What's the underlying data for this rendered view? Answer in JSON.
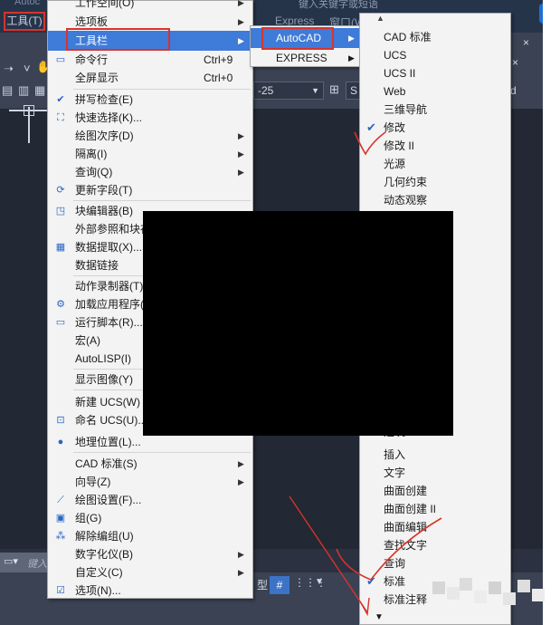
{
  "window": {
    "app_title": "Autoc",
    "tools_menu_label": "工具(T)",
    "express_menu_label": "Express",
    "window_menu_label": "窗口(W)",
    "search_hint": "键入关键字或短语"
  },
  "ribbon": {
    "dimstyle_value": "-25",
    "textstyle_value": "S",
    "standard_value": "ndard",
    "close_glyph": "×"
  },
  "tools_menu": {
    "items": [
      {
        "label": "工作空间(O)",
        "shortcut": "",
        "submenu": true
      },
      {
        "label": "选项板",
        "shortcut": "",
        "submenu": true
      },
      {
        "label": "工具栏",
        "shortcut": "",
        "submenu": true
      },
      {
        "label": "命令行",
        "shortcut": "Ctrl+9",
        "submenu": false
      },
      {
        "label": "全屏显示",
        "shortcut": "Ctrl+0",
        "submenu": false
      },
      {
        "label": "拼写检查(E)",
        "shortcut": "",
        "submenu": false
      },
      {
        "label": "快速选择(K)...",
        "shortcut": "",
        "submenu": false
      },
      {
        "label": "绘图次序(D)",
        "shortcut": "",
        "submenu": true
      },
      {
        "label": "隔离(I)",
        "shortcut": "",
        "submenu": true
      },
      {
        "label": "查询(Q)",
        "shortcut": "",
        "submenu": true
      },
      {
        "label": "更新字段(T)",
        "shortcut": "",
        "submenu": false
      },
      {
        "label": "块编辑器(B)",
        "shortcut": "",
        "submenu": false
      },
      {
        "label": "外部参照和块在",
        "shortcut": "",
        "submenu": false
      },
      {
        "label": "数据提取(X)...",
        "shortcut": "",
        "submenu": false
      },
      {
        "label": "数据链接",
        "shortcut": "",
        "submenu": false
      },
      {
        "label": "动作录制器(T)",
        "shortcut": "",
        "submenu": false
      },
      {
        "label": "加载应用程序(",
        "shortcut": "",
        "submenu": false
      },
      {
        "label": "运行脚本(R)...",
        "shortcut": "",
        "submenu": false
      },
      {
        "label": "宏(A)",
        "shortcut": "",
        "submenu": false
      },
      {
        "label": "AutoLISP(I)",
        "shortcut": "",
        "submenu": false
      },
      {
        "label": "显示图像(Y)",
        "shortcut": "",
        "submenu": false
      },
      {
        "label": "新建 UCS(W)",
        "shortcut": "",
        "submenu": false
      },
      {
        "label": "命名 UCS(U)...",
        "shortcut": "",
        "submenu": false
      },
      {
        "label": "地理位置(L)...",
        "shortcut": "",
        "submenu": false
      },
      {
        "label": "CAD 标准(S)",
        "shortcut": "",
        "submenu": true
      },
      {
        "label": "向导(Z)",
        "shortcut": "",
        "submenu": true
      },
      {
        "label": "绘图设置(F)...",
        "shortcut": "",
        "submenu": false
      },
      {
        "label": "组(G)",
        "shortcut": "",
        "submenu": false
      },
      {
        "label": "解除编组(U)",
        "shortcut": "",
        "submenu": false
      },
      {
        "label": "数字化仪(B)",
        "shortcut": "",
        "submenu": true
      },
      {
        "label": "自定义(C)",
        "shortcut": "",
        "submenu": true
      },
      {
        "label": "选项(N)...",
        "shortcut": "",
        "submenu": false
      }
    ],
    "highlighted_item": "工具栏"
  },
  "toolbar_submenu": {
    "items": [
      "AutoCAD",
      "EXPRESS"
    ],
    "highlighted_item": "AutoCAD"
  },
  "toolbar_list": {
    "items_top": [
      {
        "label": "CAD 标准",
        "checked": false
      },
      {
        "label": "UCS",
        "checked": false
      },
      {
        "label": "UCS II",
        "checked": false
      },
      {
        "label": "Web",
        "checked": false
      },
      {
        "label": "三维导航",
        "checked": false
      },
      {
        "label": "修改",
        "checked": true
      },
      {
        "label": "修改 II",
        "checked": false
      },
      {
        "label": "光源",
        "checked": false
      },
      {
        "label": "几何约束",
        "checked": false
      },
      {
        "label": "动态观察",
        "checked": false
      }
    ],
    "items_bottom": [
      {
        "label": "建筑",
        "checked": false
      },
      {
        "label": "插入",
        "checked": false
      },
      {
        "label": "文字",
        "checked": false
      },
      {
        "label": "曲面创建",
        "checked": false
      },
      {
        "label": "曲面创建 II",
        "checked": false
      },
      {
        "label": "曲面编辑",
        "checked": false
      },
      {
        "label": "查找文字",
        "checked": false
      },
      {
        "label": "查询",
        "checked": false
      },
      {
        "label": "标准",
        "checked": true
      },
      {
        "label": "标准注释",
        "checked": false
      }
    ]
  },
  "command_line": {
    "placeholder": "键入"
  },
  "statusbar": {
    "model_label": "型",
    "grid_glyph": "#",
    "snap_glyph": "⋮⋮⋮"
  },
  "colors": {
    "highlight": "#3f7bd8",
    "annotation_red": "#d8332b",
    "check_blue": "#2a66c4"
  }
}
